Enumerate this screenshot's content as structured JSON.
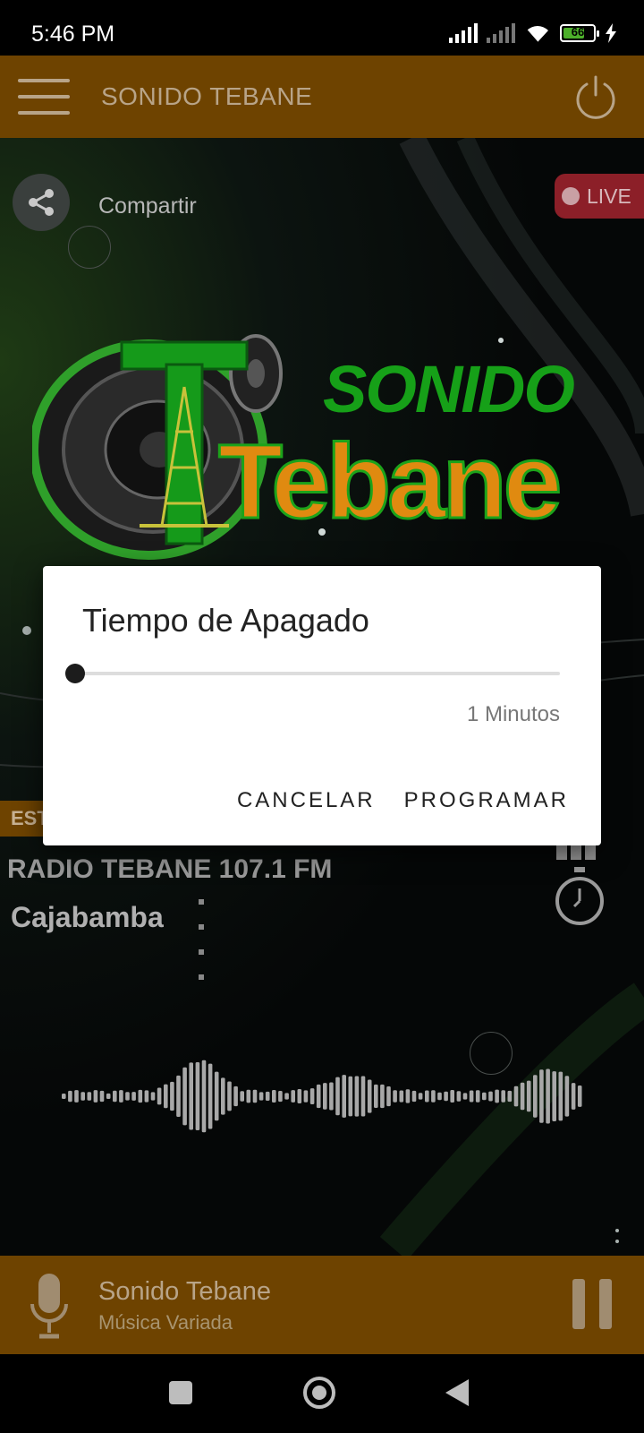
{
  "status_bar": {
    "time": "5:46 PM",
    "battery_level": "66",
    "icons": [
      "signal-icon",
      "signal-no-service-icon",
      "wifi-icon",
      "battery-icon",
      "charging-icon"
    ]
  },
  "app_bar": {
    "title": "SONIDO TEBANE",
    "menu_icon": "hamburger-menu-icon",
    "power_icon": "power-icon"
  },
  "main": {
    "share_label": "Compartir",
    "live_label": "LIVE",
    "logo_text_top": "SONIDO",
    "logo_text_bottom": "Tebane",
    "station_tag": "EST",
    "station_name": "RADIO TEBANE 107.1 FM",
    "station_city": "Cajabamba"
  },
  "dialog": {
    "title": "Tiempo de Apagado",
    "slider_fraction": 0.0,
    "slider_value_label": "1 Minutos",
    "cancel_label": "CANCELAR",
    "confirm_label": "PROGRAMAR"
  },
  "player": {
    "title": "Sonido Tebane",
    "subtitle": "Música Variada",
    "pause_icon": "pause-icon"
  },
  "colors": {
    "bar_brown": "#6e4300",
    "live_red": "#8c1f28",
    "logo_green": "#16a018",
    "logo_orange": "#e08a10"
  }
}
